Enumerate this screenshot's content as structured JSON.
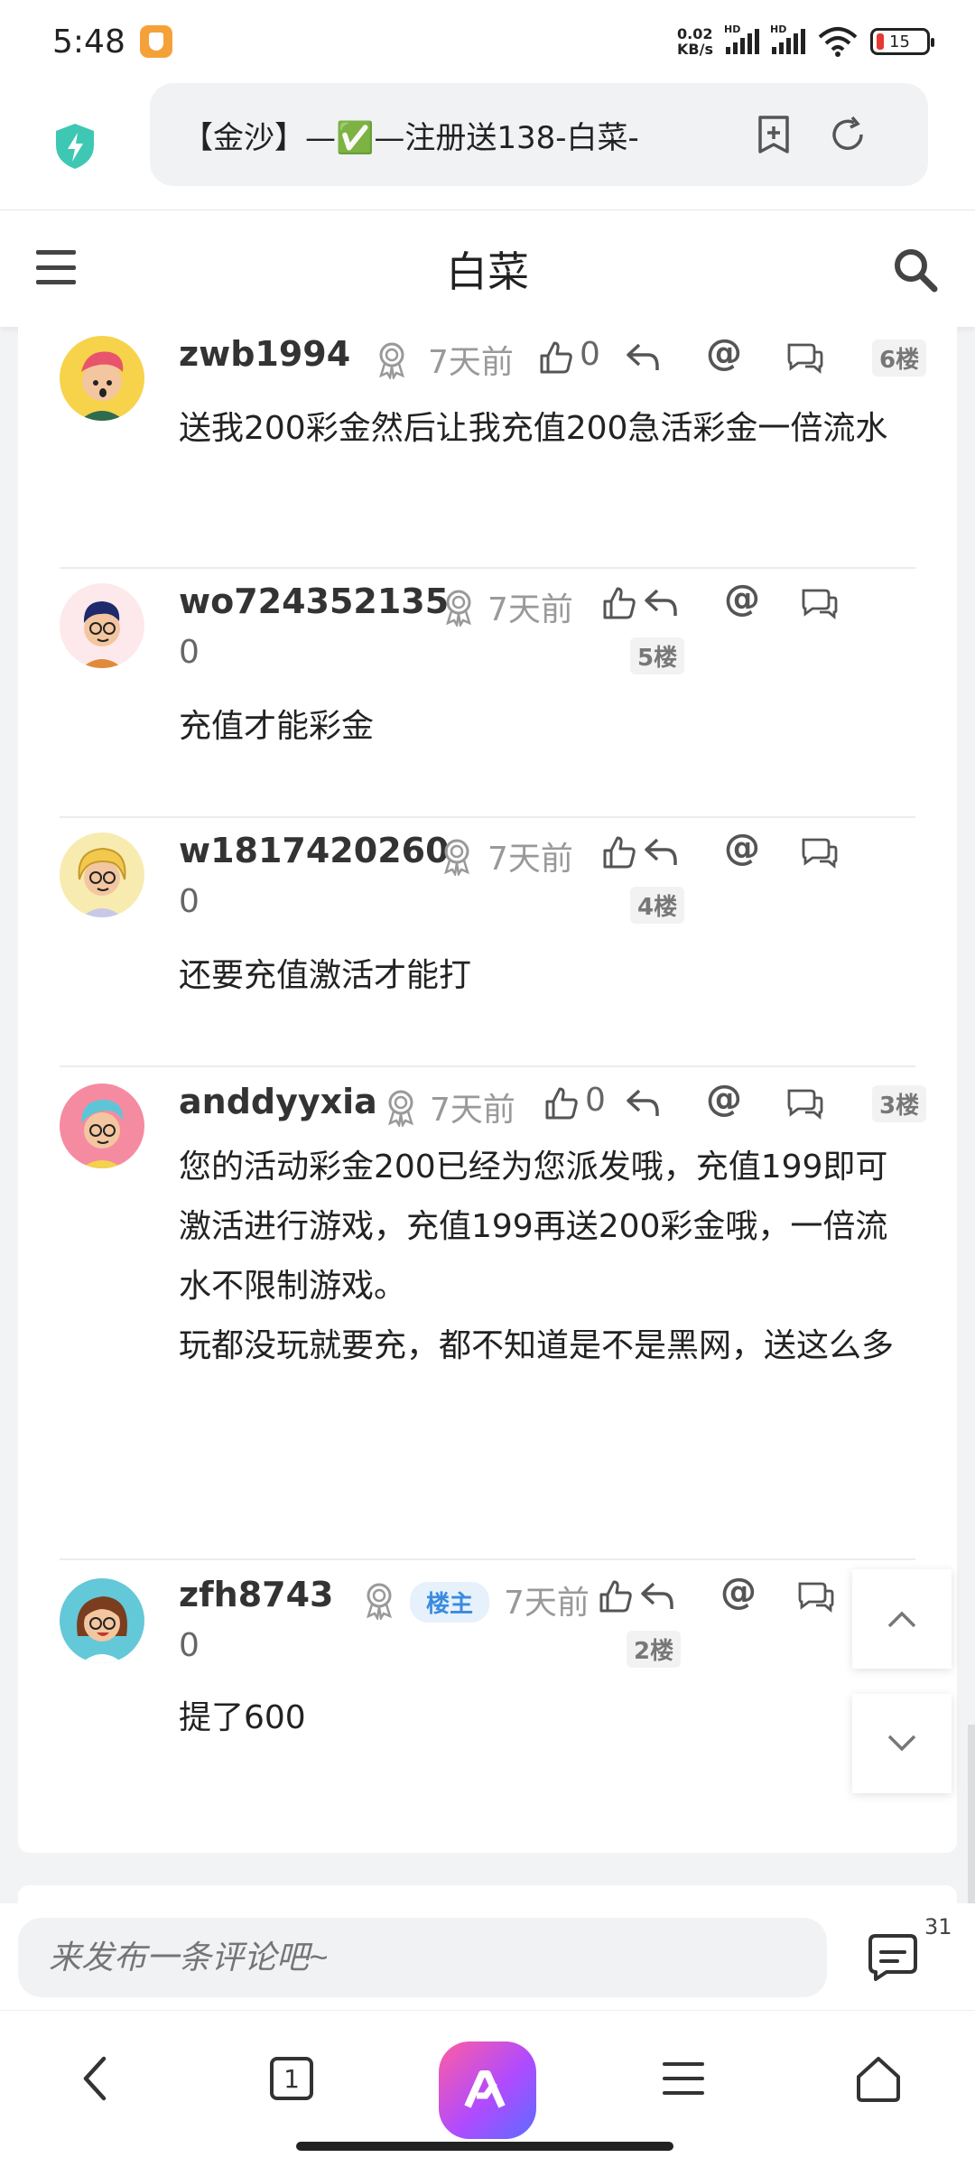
{
  "status": {
    "time": "5:48",
    "net_speed_value": "0.02",
    "net_speed_unit": "KB/s",
    "signal1_label": "HD",
    "signal2_label": "HD",
    "battery": "15",
    "battery_color": "#e53935"
  },
  "browser": {
    "url_title": "【金沙】—✅—注册送138-白菜-",
    "icons": [
      "shield-icon",
      "add-bookmark-icon",
      "refresh-icon"
    ]
  },
  "header": {
    "title": "白菜",
    "icons": [
      "menu-icon",
      "search-icon"
    ]
  },
  "comments": [
    {
      "username": "zwb1994",
      "time": "7天前",
      "likes": "0",
      "floor": "6楼",
      "body": "送我200彩金然后让我充值200急活彩金一倍流水",
      "is_owner": false
    },
    {
      "username": "wo724352135",
      "time": "7天前",
      "likes": "0",
      "floor": "5楼",
      "body": "充值才能彩金",
      "is_owner": false
    },
    {
      "username": "w1817420260",
      "time": "7天前",
      "likes": "0",
      "floor": "4楼",
      "body": "还要充值激活才能打",
      "is_owner": false
    },
    {
      "username": "anddyyxia",
      "time": "7天前",
      "likes": "0",
      "floor": "3楼",
      "body_p1": "您的活动彩金200已经为您派发哦，充值199即可激活进行游戏，充值199再送200彩金哦，一倍流水不限制游戏。",
      "body_p2": "玩都没玩就要充，都不知道是不是黑网，送这么多",
      "is_owner": false
    },
    {
      "username": "zfh8743",
      "owner_tag": "楼主",
      "time": "7天前",
      "likes": "0",
      "floor": "2楼",
      "body": "提了600",
      "is_owner": true
    }
  ],
  "comment_bar": {
    "placeholder": "来发布一条评论吧~",
    "count": "31"
  },
  "navbar": {
    "tabs_count": "1",
    "icons": [
      "back-icon",
      "tabs-icon",
      "app-logo-icon",
      "menu-lines-icon",
      "home-icon"
    ]
  },
  "colors": {
    "accent_blue": "#3a8be0",
    "muted_text": "#999999"
  }
}
